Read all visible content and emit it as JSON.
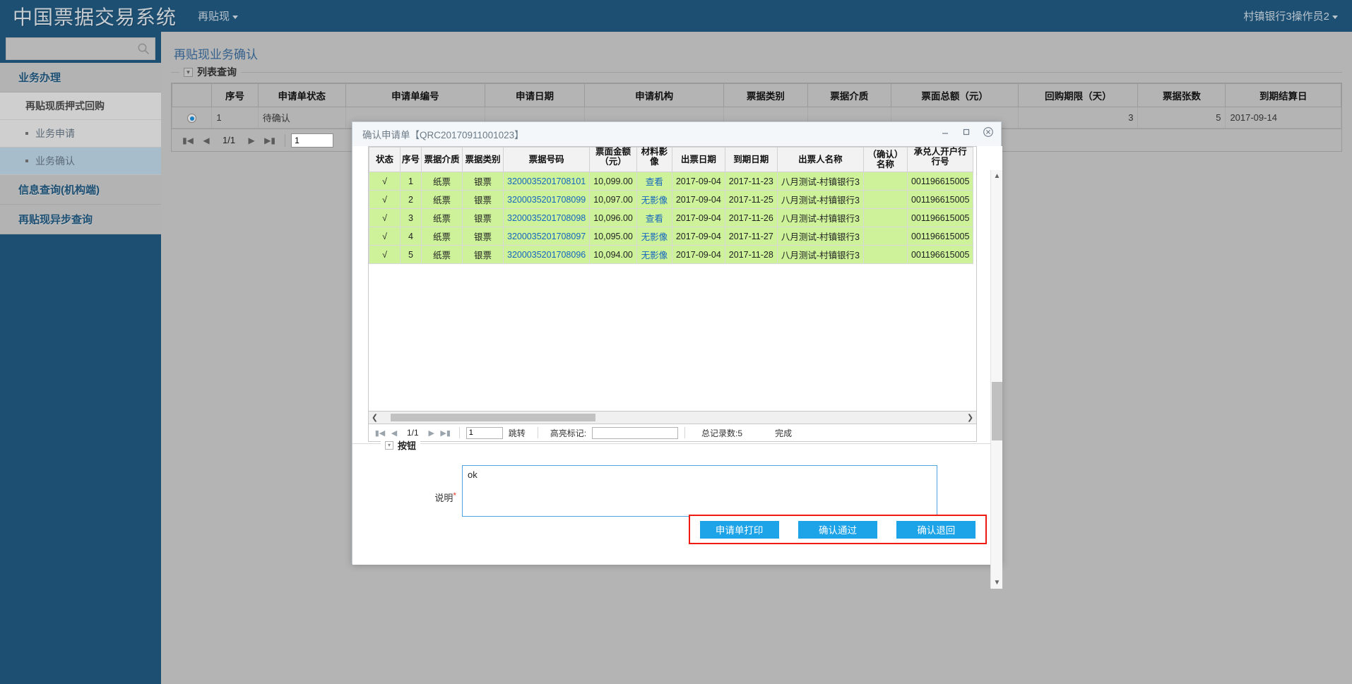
{
  "topbar": {
    "brand": "中国票据交易系统",
    "nav_label": "再贴现",
    "user_label": "村镇银行3操作员2"
  },
  "sidebar": {
    "search_placeholder": "",
    "search_value": "",
    "search_icon": "search-icon",
    "items": [
      {
        "label": "业务办理",
        "type": "group"
      },
      {
        "label": "再贴现质押式回购",
        "type": "sub"
      },
      {
        "label": "业务申请",
        "type": "leaf",
        "active": false
      },
      {
        "label": "业务确认",
        "type": "leaf",
        "active": true
      },
      {
        "label": "信息查询(机构端)",
        "type": "group"
      },
      {
        "label": "再贴现异步查询",
        "type": "group"
      }
    ]
  },
  "main": {
    "page_title": "再贴现业务确认",
    "fieldset_legend": "列表查询",
    "grid": {
      "columns": [
        "序号",
        "申请单状态",
        "申请单编号",
        "申请日期",
        "申请机构",
        "票据类别",
        "票据介质",
        "票面总额（元）",
        "回购期限（天）",
        "票据张数",
        "到期结算日"
      ],
      "rows": [
        {
          "selected": true,
          "序号": "1",
          "申请单状态": "待确认",
          "申请单编号": "",
          "申请日期": "",
          "申请机构": "",
          "票据类别": "",
          "票据介质": "",
          "票面总额（元）": "",
          "回购期限（天）": "3",
          "票据张数": "5",
          "到期结算日": "2017-09-14"
        }
      ]
    },
    "pager": {
      "first_icon": "first-page-icon",
      "prev_icon": "prev-page-icon",
      "page_text": "1/1",
      "next_icon": "next-page-icon",
      "last_icon": "last-page-icon",
      "page_input": "1"
    }
  },
  "modal": {
    "title": "确认申请单【QRC20170911001023】",
    "minimize_icon": "minimize-icon",
    "maximize_icon": "maximize-icon",
    "close_icon": "close-icon",
    "grid": {
      "columns": [
        "状态",
        "序号",
        "票据介质",
        "票据类别",
        "票据号码",
        "票面金额（元）",
        "material-image",
        "出票日期",
        "到期日期",
        "出票人名称",
        "（确认）名称",
        "承兑人开户行行号"
      ],
      "column_top_clipped": {
        "amount": "票面金额",
        "amount_second": "（元）",
        "image": "材料影像",
        "image_second": "像",
        "bank": "承兑人开户行",
        "bank_second": "行号"
      },
      "rows": [
        {
          "状态": "√",
          "序号": "1",
          "票据介质": "纸票",
          "票据类别": "银票",
          "票据号码": "3200035201708101",
          "票面金额": "10,099.00",
          "影像": "查看",
          "出票日期": "2017-09-04",
          "到期日期": "2017-11-23",
          "出票人名称": "八月测试-村镇银行3",
          "确认名称": "",
          "行号": "001196615005"
        },
        {
          "状态": "√",
          "序号": "2",
          "票据介质": "纸票",
          "票据类别": "银票",
          "票据号码": "3200035201708099",
          "票面金额": "10,097.00",
          "影像": "无影像",
          "出票日期": "2017-09-04",
          "到期日期": "2017-11-25",
          "出票人名称": "八月测试-村镇银行3",
          "确认名称": "",
          "行号": "001196615005"
        },
        {
          "状态": "√",
          "序号": "3",
          "票据介质": "纸票",
          "票据类别": "银票",
          "票据号码": "3200035201708098",
          "票面金额": "10,096.00",
          "影像": "查看",
          "出票日期": "2017-09-04",
          "到期日期": "2017-11-26",
          "出票人名称": "八月测试-村镇银行3",
          "确认名称": "",
          "行号": "001196615005"
        },
        {
          "状态": "√",
          "序号": "4",
          "票据介质": "纸票",
          "票据类别": "银票",
          "票据号码": "3200035201708097",
          "票面金额": "10,095.00",
          "影像": "无影像",
          "出票日期": "2017-09-04",
          "到期日期": "2017-11-27",
          "出票人名称": "八月测试-村镇银行3",
          "确认名称": "",
          "行号": "001196615005"
        },
        {
          "状态": "√",
          "序号": "5",
          "票据介质": "纸票",
          "票据类别": "银票",
          "票据号码": "3200035201708096",
          "票面金额": "10,094.00",
          "影像": "无影像",
          "出票日期": "2017-09-04",
          "到期日期": "2017-11-28",
          "出票人名称": "八月测试-村镇银行3",
          "确认名称": "",
          "行号": "001196615005"
        }
      ]
    },
    "pager": {
      "first_icon": "first-page-icon",
      "prev_icon": "prev-page-icon",
      "page_text": "1/1",
      "next_icon": "next-page-icon",
      "last_icon": "last-page-icon",
      "page_input": "1",
      "jump_label": "跳转",
      "highlight_label": "高亮标记:",
      "highlight_value": "",
      "total_label": "总记录数:5",
      "done_label": "完成"
    },
    "button_section_legend": "按钮",
    "desc_label": "说明",
    "desc_required": "*",
    "desc_value": "ok",
    "buttons": [
      {
        "label": "申请单打印",
        "name": "print-application-button"
      },
      {
        "label": "确认通过",
        "name": "confirm-pass-button"
      },
      {
        "label": "确认退回",
        "name": "confirm-return-button"
      }
    ]
  },
  "colors": {
    "header_blue": "#1d4f73",
    "accent_blue": "#1ca3e8",
    "row_green": "#cdf29a",
    "link_blue": "#1565c0",
    "alert_red": "#f01a10"
  }
}
